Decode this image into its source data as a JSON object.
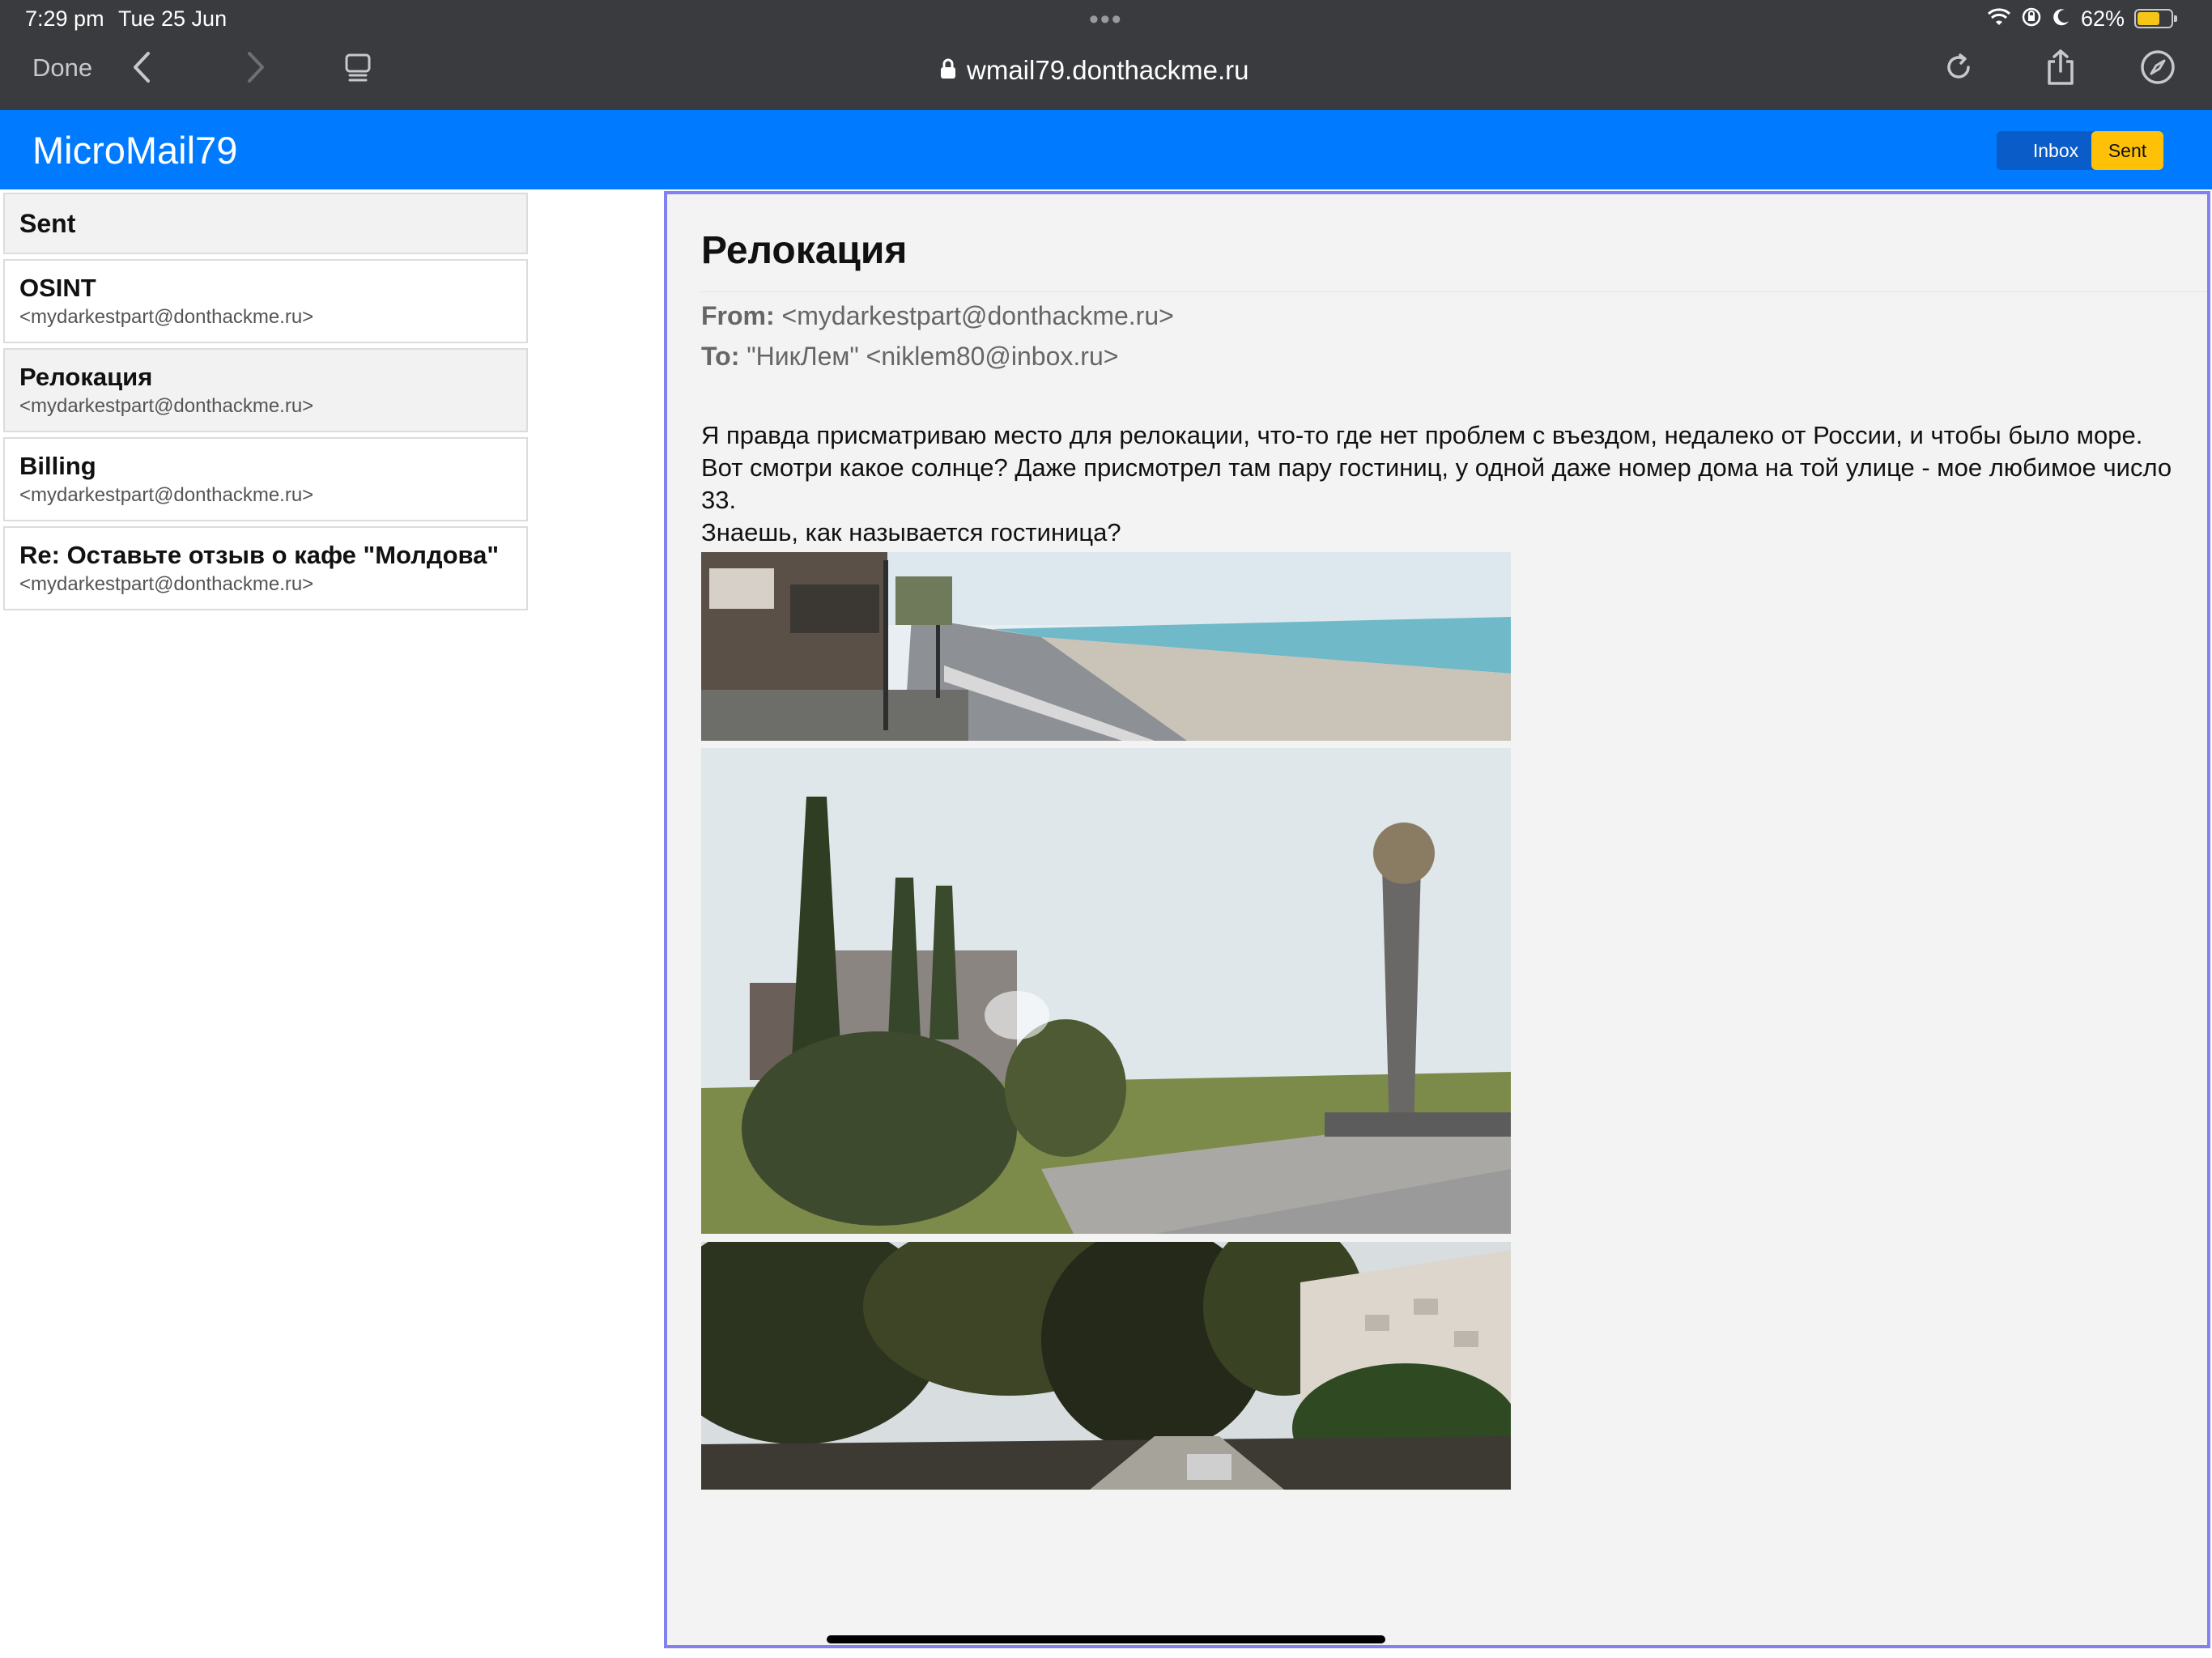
{
  "status_bar": {
    "time": "7:29 pm",
    "date": "Tue 25 Jun",
    "battery": "62%"
  },
  "browser": {
    "done_label": "Done",
    "url": "wmail79.donthackme.ru"
  },
  "app": {
    "title": "MicroMail79",
    "inbox_label": "Inbox",
    "sent_label": "Sent",
    "accent": "#007bff"
  },
  "sidebar": {
    "heading": "Sent",
    "items": [
      {
        "subject": "OSINT",
        "from": "<mydarkestpart@donthackme.ru>"
      },
      {
        "subject": "Релокация",
        "from": "<mydarkestpart@donthackme.ru>"
      },
      {
        "subject": "Billing",
        "from": "<mydarkestpart@donthackme.ru>"
      },
      {
        "subject": "Re: Оставьте отзыв о кафе \"Молдова\"",
        "from": "<mydarkestpart@donthackme.ru>"
      }
    ]
  },
  "message": {
    "subject": "Релокация",
    "from_label": "From:",
    "from": "<mydarkestpart@donthackme.ru>",
    "to_label": "To:",
    "to": "\"НикЛем\" <niklem80@inbox.ru>",
    "body_line1": "Я правда присматриваю место для релокации, что-то где нет проблем с въездом, недалеко от России, и чтобы было море.",
    "body_line2": "Вот смотри какое солнце? Даже присмотрел там пару гостиниц, у одной даже номер дома на той улице - мое любимое число 33.",
    "body_line3": "Знаешь, как называется гостиница?"
  }
}
